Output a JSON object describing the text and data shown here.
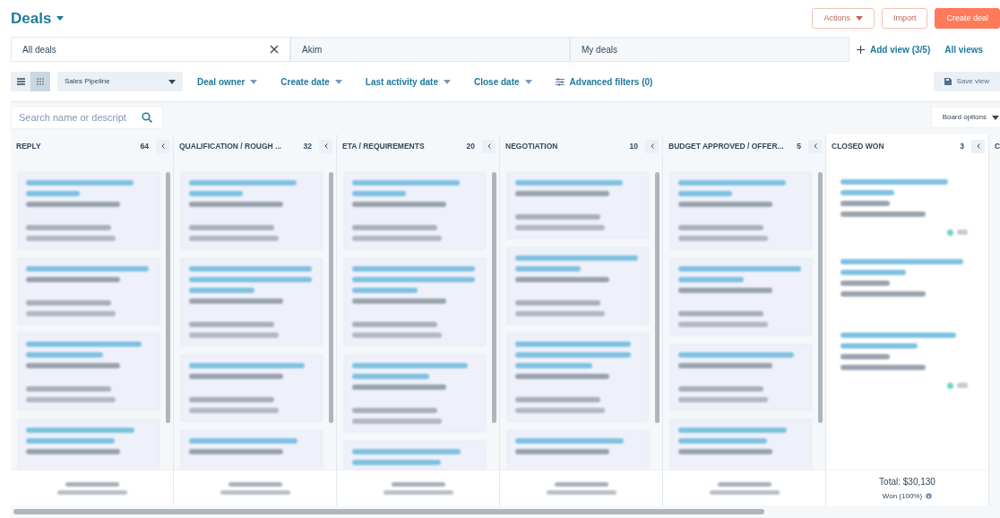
{
  "header": {
    "title": "Deals",
    "actions": [
      {
        "label": "Actions",
        "kind": "menu"
      },
      {
        "label": "Import",
        "kind": "plain"
      },
      {
        "label": "Create deal",
        "kind": "primary"
      }
    ]
  },
  "views": {
    "tabs": [
      {
        "label": "All deals",
        "selected": true
      },
      {
        "label": "Akim",
        "selected": false
      },
      {
        "label": "My deals",
        "selected": false
      }
    ],
    "add_view": "Add view (3/5)",
    "all_views": "All views"
  },
  "filters": {
    "layout": [
      {
        "kind": "list",
        "selected": false
      },
      {
        "kind": "board",
        "selected": true
      }
    ],
    "pipeline": "Sales Pipeline",
    "items": [
      "Deal owner",
      "Create date",
      "Last activity date",
      "Close date"
    ],
    "advanced": "Advanced filters (0)",
    "save_view": "Save view"
  },
  "search": {
    "placeholder": "Search name or descript"
  },
  "board_options": "Board options",
  "columns": [
    {
      "kind": "open",
      "title": "REPLY",
      "count": "64",
      "cards": [
        {
          "kind": "deal"
        },
        {
          "kind": "deal"
        },
        {
          "kind": "deal"
        },
        {
          "kind": "deal"
        }
      ]
    },
    {
      "kind": "open",
      "title": "QUALIFICATION / ROUGH ...",
      "count": "32",
      "cards": [
        {
          "kind": "deal"
        },
        {
          "kind": "deal"
        },
        {
          "kind": "deal"
        },
        {
          "kind": "deal"
        }
      ]
    },
    {
      "kind": "open",
      "title": "ETA / REQUIREMENTS",
      "count": "20",
      "cards": [
        {
          "kind": "deal"
        },
        {
          "kind": "deal"
        },
        {
          "kind": "deal"
        },
        {
          "kind": "deal"
        }
      ]
    },
    {
      "kind": "open",
      "title": "NEGOTIATION",
      "count": "10",
      "cards": [
        {
          "kind": "deal"
        },
        {
          "kind": "deal"
        },
        {
          "kind": "deal"
        },
        {
          "kind": "deal"
        }
      ]
    },
    {
      "kind": "open",
      "title": "BUDGET APPROVED / OFFER...",
      "count": "5",
      "cards": [
        {
          "kind": "deal"
        },
        {
          "kind": "deal"
        },
        {
          "kind": "deal"
        },
        {
          "kind": "deal"
        }
      ]
    },
    {
      "kind": "won",
      "title": "CLOSED WON",
      "count": "3",
      "cards": [
        {
          "kind": "won"
        },
        {
          "kind": "won"
        },
        {
          "kind": "won"
        }
      ],
      "total": "Total: $30,130",
      "won": "Won (100%)"
    },
    {
      "kind": "cut",
      "title": "C"
    }
  ]
}
